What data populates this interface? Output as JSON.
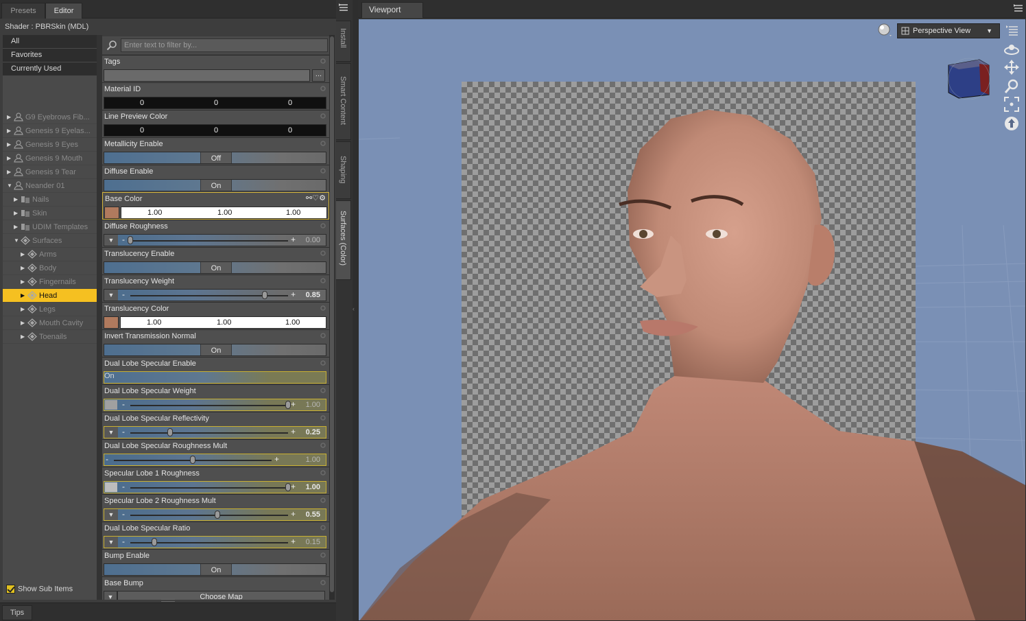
{
  "left_tabs": [
    "Presets",
    "Editor"
  ],
  "shader_label": "Shader :  PBRSkin (MDL)",
  "menu": [
    "All",
    "Favorites",
    "Currently Used"
  ],
  "tree": [
    {
      "label": "G9 Eyebrows Fib...",
      "depth": 0,
      "icon": "figure-icon"
    },
    {
      "label": "Genesis 9 Eyelas...",
      "depth": 0,
      "icon": "figure-icon"
    },
    {
      "label": "Genesis 9 Eyes",
      "depth": 0,
      "icon": "figure-icon"
    },
    {
      "label": "Genesis 9 Mouth",
      "depth": 0,
      "icon": "figure-icon"
    },
    {
      "label": "Genesis 9 Tear",
      "depth": 0,
      "icon": "figure-icon"
    },
    {
      "label": "Neander 01",
      "depth": 0,
      "icon": "figure-icon",
      "expanded": true
    },
    {
      "label": "Nails",
      "depth": 1,
      "icon": "folder-icon"
    },
    {
      "label": "Skin",
      "depth": 1,
      "icon": "folder-icon"
    },
    {
      "label": "UDIM Templates",
      "depth": 1,
      "icon": "folder-icon"
    },
    {
      "label": "Surfaces",
      "depth": 1,
      "icon": "surface-icon",
      "expanded": true
    },
    {
      "label": "Arms",
      "depth": 2,
      "icon": "surface-icon"
    },
    {
      "label": "Body",
      "depth": 2,
      "icon": "surface-icon"
    },
    {
      "label": "Fingernails",
      "depth": 2,
      "icon": "surface-icon"
    },
    {
      "label": "Head",
      "depth": 2,
      "icon": "surface-icon",
      "selected": true
    },
    {
      "label": "Legs",
      "depth": 2,
      "icon": "surface-icon"
    },
    {
      "label": "Mouth Cavity",
      "depth": 2,
      "icon": "surface-icon"
    },
    {
      "label": "Toenails",
      "depth": 2,
      "icon": "surface-icon"
    }
  ],
  "show_sub_items": "Show Sub Items",
  "filter_placeholder": "Enter text to filter by...",
  "tags_button": "...",
  "properties": [
    {
      "label": "Tags",
      "kind": "tags"
    },
    {
      "label": "Material ID",
      "kind": "triple",
      "values": [
        "0",
        "0",
        "0"
      ]
    },
    {
      "label": "Line Preview Color",
      "kind": "triple",
      "values": [
        "0",
        "0",
        "0"
      ]
    },
    {
      "label": "Metallicity Enable",
      "kind": "toggle",
      "value": "Off"
    },
    {
      "label": "Diffuse Enable",
      "kind": "toggle",
      "value": "On"
    },
    {
      "label": "Base Color",
      "kind": "color",
      "values": [
        "1.00",
        "1.00",
        "1.00"
      ],
      "highlight": true
    },
    {
      "label": "Diffuse Roughness",
      "kind": "slider",
      "value": "0.00",
      "frac": 0.0,
      "dim": true
    },
    {
      "label": "Translucency Enable",
      "kind": "toggle",
      "value": "On"
    },
    {
      "label": "Translucency Weight",
      "kind": "slider",
      "value": "0.85",
      "frac": 0.85
    },
    {
      "label": "Translucency Color",
      "kind": "color",
      "values": [
        "1.00",
        "1.00",
        "1.00"
      ]
    },
    {
      "label": "Invert Transmission Normal",
      "kind": "toggle",
      "value": "On"
    },
    {
      "label": "Dual Lobe Specular Enable",
      "kind": "toggle",
      "value": "On",
      "yellow": true
    },
    {
      "label": "Dual Lobe Specular Weight",
      "kind": "slider",
      "value": "1.00",
      "frac": 1.0,
      "swatch": "#a0a0a0",
      "yellow": true,
      "dim": true
    },
    {
      "label": "Dual Lobe Specular Reflectivity",
      "kind": "slider",
      "value": "0.25",
      "frac": 0.25,
      "yellow": true
    },
    {
      "label": "Dual Lobe Specular Roughness Mult",
      "kind": "slider",
      "value": "1.00",
      "frac": 0.5,
      "yellow": true,
      "dim": true,
      "nobtn": true
    },
    {
      "label": "Specular Lobe 1 Roughness",
      "kind": "slider",
      "value": "1.00",
      "frac": 1.0,
      "swatch": "#bdbdbd",
      "yellow": true
    },
    {
      "label": "Specular Lobe 2 Roughness Mult",
      "kind": "slider",
      "value": "0.55",
      "frac": 0.55,
      "yellow": true
    },
    {
      "label": "Dual Lobe Specular Ratio",
      "kind": "slider",
      "value": "0.15",
      "frac": 0.15,
      "yellow": true,
      "dim": true
    },
    {
      "label": "Bump Enable",
      "kind": "toggle",
      "value": "On"
    },
    {
      "label": "Base Bump",
      "kind": "map",
      "value": "Choose Map"
    }
  ],
  "tips_tab": "Tips",
  "side_tabs": [
    "Install",
    "Smart Content",
    "Shaping",
    "Surfaces (Color)"
  ],
  "viewport_tab": "Viewport",
  "camera_select": "Perspective View",
  "colors": {
    "selected": "#f5c021",
    "viewport_bg": "#7a90b5",
    "highlight_border": "#d4b43a"
  }
}
